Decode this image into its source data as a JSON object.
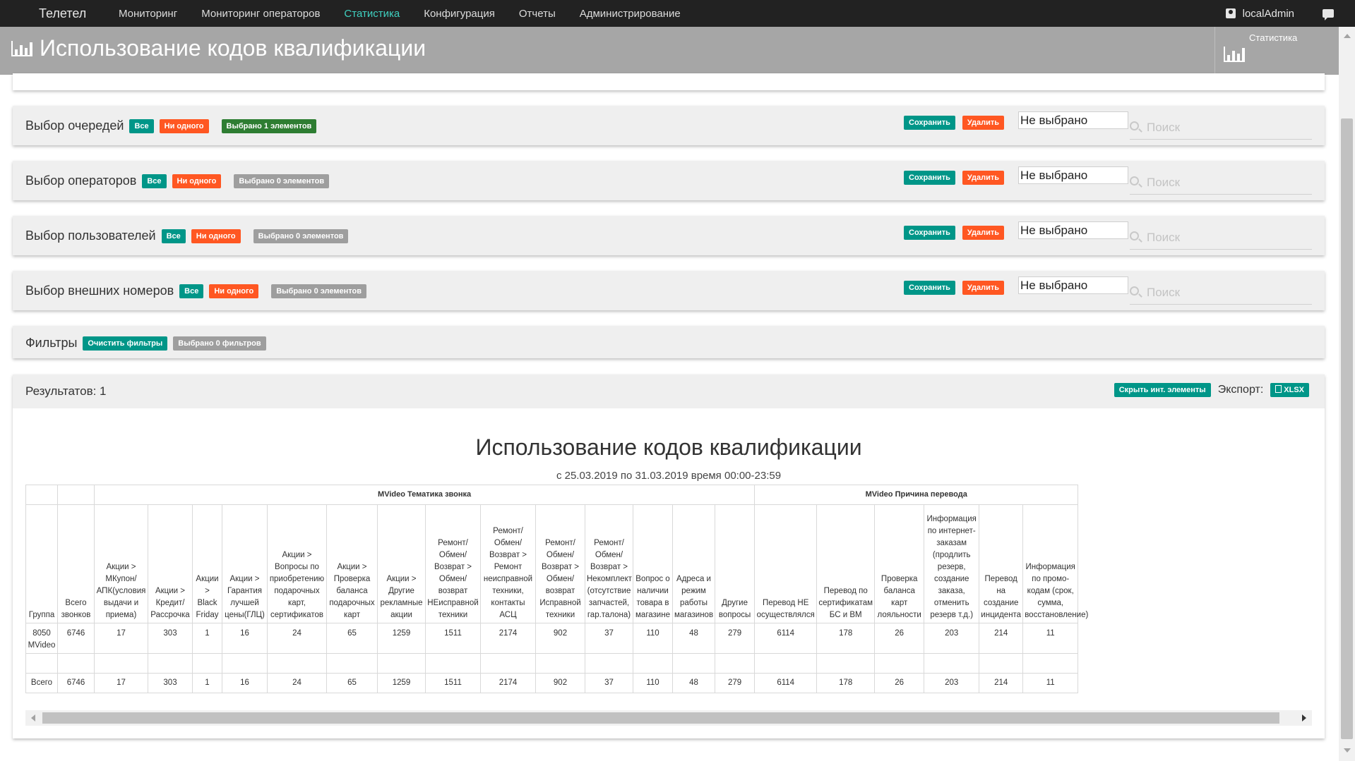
{
  "nav": {
    "brand": "Телетел",
    "items": [
      "Мониторинг",
      "Мониторинг операторов",
      "Статистика",
      "Конфигурация",
      "Отчеты",
      "Администрирование"
    ],
    "active_index": 2,
    "user": "localAdmin"
  },
  "header": {
    "title": "Использование кодов квалификации",
    "right_label": "Статистика"
  },
  "panels": [
    {
      "title": "Выбор очередей",
      "all": "Все",
      "none": "Ни одного",
      "selected": "Выбрано 1 элементов",
      "save": "Сохранить",
      "delete": "Удалить",
      "select_value": "Не выбрано",
      "search_placeholder": "Поиск"
    },
    {
      "title": "Выбор операторов",
      "all": "Все",
      "none": "Ни одного",
      "selected": "Выбрано 0 элементов",
      "save": "Сохранить",
      "delete": "Удалить",
      "select_value": "Не выбрано",
      "search_placeholder": "Поиск"
    },
    {
      "title": "Выбор пользователей",
      "all": "Все",
      "none": "Ни одного",
      "selected": "Выбрано 0 элементов",
      "save": "Сохранить",
      "delete": "Удалить",
      "select_value": "Не выбрано",
      "search_placeholder": "Поиск"
    },
    {
      "title": "Выбор внешних номеров",
      "all": "Все",
      "none": "Ни одного",
      "selected": "Выбрано 0 элементов",
      "save": "Сохранить",
      "delete": "Удалить",
      "select_value": "Не выбрано",
      "search_placeholder": "Поиск"
    }
  ],
  "filters": {
    "title": "Фильтры",
    "clear": "Очистить фильтры",
    "selected": "Выбрано 0 фильтров"
  },
  "results": {
    "count_label": "Результатов: 1",
    "hide_button": "Скрыть инт. элементы",
    "export_label": "Экспорт:",
    "xlsx_button": "XLSX"
  },
  "report": {
    "title": "Использование кодов квалификации",
    "subtitle": "с 25.03.2019 по 31.03.2019 время 00:00-23:59",
    "group_headers": [
      {
        "label": "",
        "span": 1
      },
      {
        "label": "",
        "span": 1
      },
      {
        "label": "MVideo Тематика звонка",
        "span": 14
      },
      {
        "label": "MVideo Причина перевода",
        "span": 6
      }
    ],
    "columns": [
      "Группа",
      "Всего звонков",
      "Акции > МКупон/ АПК(условия выдачи и приема)",
      "Акции > Кредит/ Рассрочка",
      "Акции > Black Friday",
      "Акции > Гарантия лучшей цены(ГЛЦ)",
      "Акции > Вопросы по приобретению подарочных карт, сертификатов",
      "Акции > Проверка баланса подарочных карт",
      "Акции > Другие рекламные акции",
      "Ремонт/ Обмен/ Возврат > Обмен/ возврат НЕисправной техники",
      "Ремонт/ Обмен/ Возврат > Ремонт неисправной техники, контакты АСЦ",
      "Ремонт/ Обмен/ Возврат > Обмен/ возврат Исправной техники",
      "Ремонт/ Обмен/ Возврат > Некомплект (отсутствие запчастей, гар.талона)",
      "Вопрос о наличии товара в магазине",
      "Адреса и режим работы магазинов",
      "Другие вопросы",
      "Перевод НЕ осуществлялся",
      "Перевод по сертификатам БС и ВМ",
      "Проверка баланса карт лояльности",
      "Информация по интернет-заказам (продлить резерв, создание заказа, отменить резерв т.д.)",
      "Перевод на создание инцидента",
      "Информация по промо-кодам (срок, сумма, восстановление)"
    ],
    "rows": [
      [
        "8050 MVideo",
        "6746",
        "17",
        "303",
        "1",
        "16",
        "24",
        "65",
        "1259",
        "1511",
        "2174",
        "902",
        "37",
        "110",
        "48",
        "279",
        "6114",
        "178",
        "26",
        "203",
        "214",
        "11"
      ]
    ],
    "total": [
      "Всего",
      "6746",
      "17",
      "303",
      "1",
      "16",
      "24",
      "65",
      "1259",
      "1511",
      "2174",
      "902",
      "37",
      "110",
      "48",
      "279",
      "6114",
      "178",
      "26",
      "203",
      "214",
      "11"
    ]
  },
  "colors": {
    "navbar": "#222222",
    "active_nav": "#3fd0c0",
    "header": "#a6a6a6",
    "teal": "#009688",
    "orange": "#ff5722",
    "green": "#2e7d32",
    "gray": "#9e9e9e"
  }
}
